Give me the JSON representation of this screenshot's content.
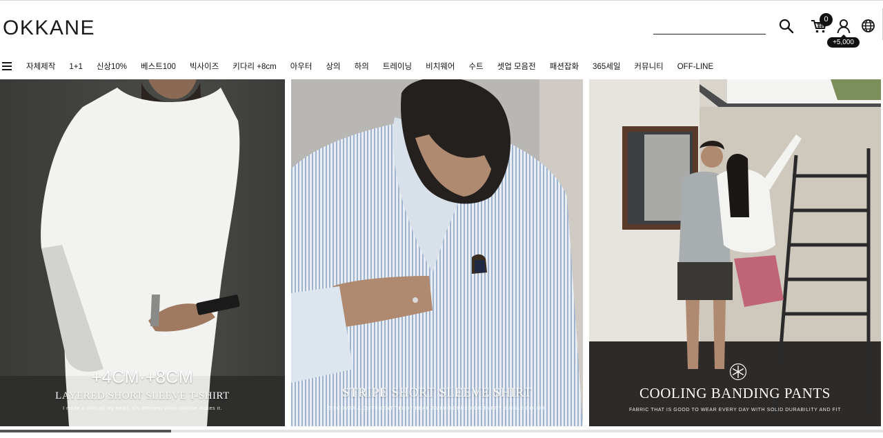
{
  "brand": {
    "logo": "OKKANE"
  },
  "header": {
    "search_value": "",
    "cart_count": "0",
    "points": "+5,000"
  },
  "nav": {
    "items": [
      "자체제작",
      "1+1",
      "신상10%",
      "베스트100",
      "빅사이즈",
      "키다리 +8cm",
      "아우터",
      "상의",
      "하의",
      "트레이닝",
      "비치웨어",
      "수트",
      "셋업 모음전",
      "패션잡화",
      "365세일",
      "커뮤니티",
      "OFF-LINE"
    ]
  },
  "banners": [
    {
      "title_top": "+4CM·+8CM",
      "title": "LAYERED SHORT SLEEVE T-SHIRT",
      "subtitle": "I made it with all my heart, it's different when okkane makes it."
    },
    {
      "title": "STRIPE SHORT SLEEVE  SHIRT",
      "subtitle": "DISCOVER A DIFFERENT TEDDY BEAR EMBROIDERED ON EVERY SINGLE COLOR."
    },
    {
      "title": "COOLING BANDING PANTS",
      "subtitle": "FABRIC THAT IS GOOD TO WEAR EVERY DAY WITH SOLID DURABILITY AND FIT"
    }
  ],
  "icons": [
    "search-icon",
    "cart-icon",
    "user-icon",
    "globe-icon",
    "menu-icon"
  ],
  "colors": {
    "text": "#111111",
    "badge": "#111111",
    "scroll_thumb": "#555555"
  }
}
